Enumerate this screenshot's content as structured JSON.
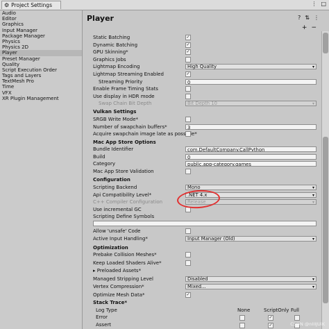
{
  "window": {
    "title": "Project Settings"
  },
  "sidebar": {
    "items": [
      "Audio",
      "Editor",
      "Graphics",
      "Input Manager",
      "Package Manager",
      "Physics",
      "Physics 2D",
      "Player",
      "Preset Manager",
      "Quality",
      "Script Execution Order",
      "Tags and Layers",
      "TextMesh Pro",
      "Time",
      "VFX",
      "XR Plugin Management"
    ],
    "selected": "Player"
  },
  "main": {
    "title": "Player",
    "rows1": [
      {
        "label": "Static Batching",
        "type": "cb",
        "checked": true
      },
      {
        "label": "Dynamic Batching",
        "type": "cb",
        "checked": true
      },
      {
        "label": "GPU Skinning*",
        "type": "cb",
        "checked": true
      },
      {
        "label": "Graphics Jobs",
        "type": "cb",
        "checked": false
      },
      {
        "label": "Lightmap Encoding",
        "type": "dd",
        "value": "High Quality"
      },
      {
        "label": "Lightmap Streaming Enabled",
        "type": "cb",
        "checked": true
      },
      {
        "label": "Streaming Priority",
        "type": "field",
        "value": "0",
        "indent": true
      },
      {
        "label": "Enable Frame Timing Stats",
        "type": "cb",
        "checked": false
      },
      {
        "label": "Use display in HDR mode",
        "type": "cb",
        "checked": false
      },
      {
        "label": "Swap Chain Bit Depth",
        "type": "dd",
        "value": "Bit Depth 10",
        "indent": true,
        "disabled": true
      }
    ],
    "vulkan": {
      "title": "Vulkan Settings",
      "rows": [
        {
          "label": "SRGB Write Mode*",
          "type": "cb",
          "checked": false
        },
        {
          "label": "Number of swapchain buffers*",
          "type": "field",
          "value": "3"
        },
        {
          "label": "Acquire swapchain image late as possible*",
          "type": "cb",
          "checked": false
        }
      ]
    },
    "mac": {
      "title": "Mac App Store Options",
      "rows": [
        {
          "label": "Bundle Identifier",
          "type": "field",
          "value": "com.DefaultCompany.CallPython"
        },
        {
          "label": "Build",
          "type": "field",
          "value": "0"
        },
        {
          "label": "Category",
          "type": "field",
          "value": "public.app-category.games"
        },
        {
          "label": "Mac App Store Validation",
          "type": "cb",
          "checked": false
        }
      ]
    },
    "configuration": {
      "title": "Configuration",
      "rows": [
        {
          "label": "Scripting Backend",
          "type": "dd",
          "value": "Mono"
        },
        {
          "label": "Api Compatibility Level*",
          "type": "dd",
          "value": ".NET 4.x"
        },
        {
          "label": "C++ Compiler Configuration",
          "type": "dd",
          "value": "Release",
          "disabled": true
        },
        {
          "label": "Use incremental GC",
          "type": "cb",
          "checked": false
        },
        {
          "label": "Scripting Define Symbols",
          "type": "none"
        }
      ],
      "rows2": [
        {
          "label": "Allow 'unsafe' Code",
          "type": "cb",
          "checked": false
        },
        {
          "label": "Active Input Handling*",
          "type": "dd",
          "value": "Input Manager (Old)"
        }
      ]
    },
    "optimization": {
      "title": "Optimization",
      "rows": [
        {
          "label": "Prebake Collision Meshes*",
          "type": "cb",
          "checked": false
        },
        {
          "label": "Keep Loaded Shaders Alive*",
          "type": "cb",
          "checked": false
        },
        {
          "label": "▸ Preloaded Assets*",
          "type": "none"
        },
        {
          "label": "Managed Stripping Level",
          "type": "dd",
          "value": "Disabled"
        },
        {
          "label": "Vertex Compression*",
          "type": "dd",
          "value": "Mixed..."
        },
        {
          "label": "Optimize Mesh Data*",
          "type": "cb",
          "checked": true
        }
      ]
    },
    "stacktrace": {
      "title": "Stack Trace*",
      "headers": [
        "Log Type",
        "None",
        "ScriptOnly",
        "Full"
      ],
      "rows": [
        {
          "label": "Error",
          "cols": [
            false,
            true,
            false
          ]
        },
        {
          "label": "Assert",
          "cols": [
            false,
            true,
            false
          ]
        }
      ]
    }
  },
  "watermark": "CSDN @nIIIJUiK"
}
